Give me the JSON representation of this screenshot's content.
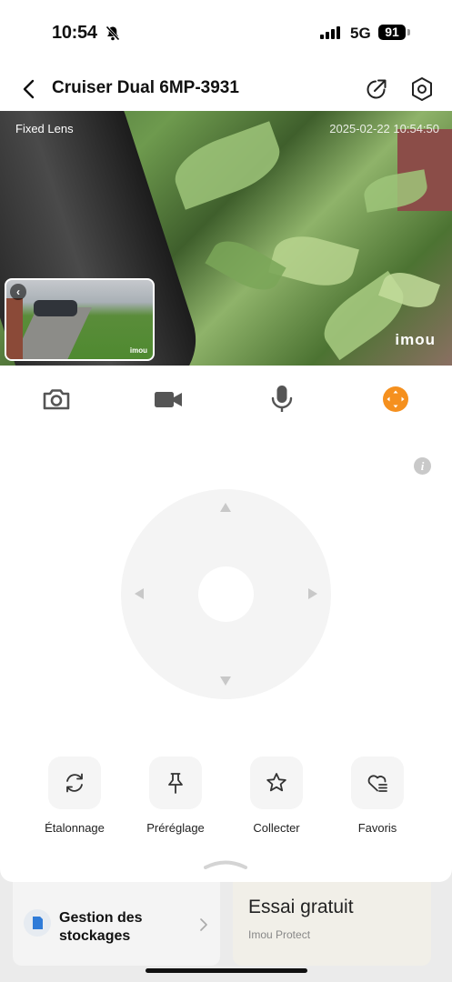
{
  "status_bar": {
    "time": "10:54",
    "network": "5G",
    "battery": "91"
  },
  "header": {
    "title": "Cruiser Dual 6MP-3931"
  },
  "video": {
    "lens_label": "Fixed Lens",
    "timestamp": "2025-02-22 10:54:50",
    "watermark": "imou",
    "pip_watermark": "imou"
  },
  "toolbar": {
    "icons": [
      "camera-icon",
      "video-record-icon",
      "microphone-icon",
      "ptz-icon"
    ],
    "active_color": "#f5901e"
  },
  "actions": [
    {
      "label": "Étalonnage",
      "icon": "calibrate-icon"
    },
    {
      "label": "Préréglage",
      "icon": "pin-icon"
    },
    {
      "label": "Collecter",
      "icon": "star-icon"
    },
    {
      "label": "Favoris",
      "icon": "heart-list-icon"
    }
  ],
  "cards": {
    "storage": {
      "label": "Gestion des stockages"
    },
    "trial": {
      "title": "Essai gratuit",
      "subtitle": "Imou Protect"
    }
  }
}
